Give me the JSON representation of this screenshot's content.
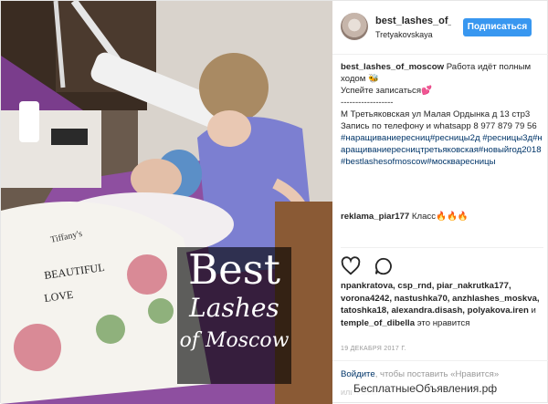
{
  "photo": {
    "overlay": {
      "line1": "Best",
      "line2": "Lashes",
      "line3": "of Moscow"
    },
    "shirt_words": [
      "BEAUTIFUL",
      "LOVE",
      "Tiffany's"
    ]
  },
  "header": {
    "username": "best_lashes_of_moscow",
    "location": "Tretyakovskaya",
    "follow_label": "Подписаться"
  },
  "caption": {
    "author": "best_lashes_of_moscow",
    "text1": "Работа идёт полным ходом",
    "emoji1": "🐝",
    "line2": "Успейте записаться",
    "emoji2": "💕",
    "dashes": "------------------",
    "address": "М Третьяковская ул Малая Ордынка д 13 стр3",
    "phone": "Запись по телефону и whatsapp 8 977 879 79 56",
    "hashtags": "#наращиваниересниц#ресницы2д #ресницы3д#наращиваниересництретьяковская#новыйгод2018#bestlashesofmoscow#москваресницы"
  },
  "comment": {
    "author": "reklama_piar177",
    "text": "Класс",
    "emoji": "🔥🔥🔥"
  },
  "likes": {
    "names": "npankratova, csp_rnd, piar_nakrutka177, vorona4242, nastushka70, anzhlashes_moskva, tatoshka18, alexandra.disash, polyakova.iren",
    "and": "и",
    "last": "temple_of_dibella",
    "suffix": "это нравится"
  },
  "date": "19 ДЕКАБРЯ 2017 Г.",
  "login": {
    "link": "Войдите",
    "text": ", чтобы поставить «Нравится»"
  },
  "watermark": "БесплатныеОбъявления.рф",
  "watermark_partial": "или комм"
}
